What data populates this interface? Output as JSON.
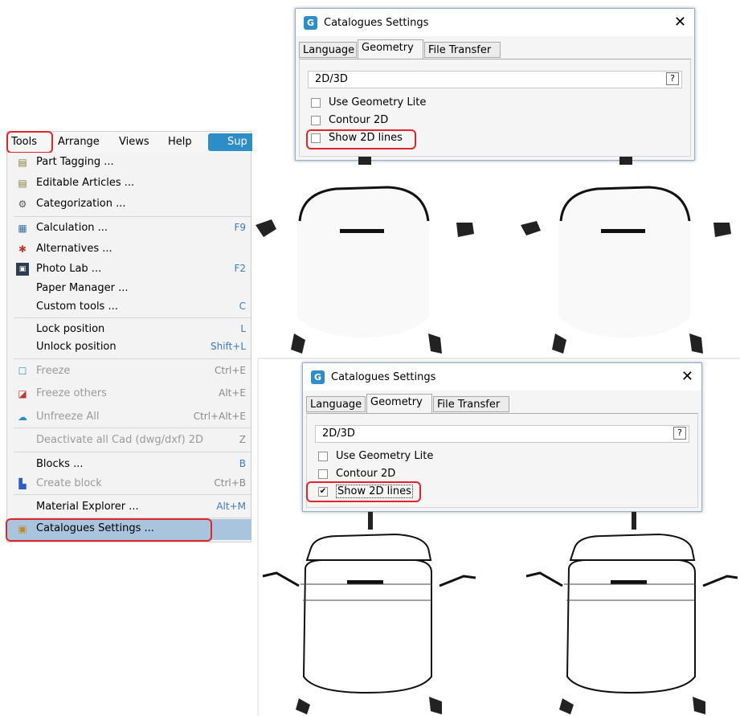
{
  "menubar": {
    "items": [
      "Tools",
      "Arrange",
      "Views",
      "Help"
    ],
    "sup_button": "Sup"
  },
  "tools_menu": {
    "items": [
      {
        "label": "Part Tagging ...",
        "icon": "part-tagging-icon",
        "shortcut": "",
        "disabled": false
      },
      {
        "label": "Editable Articles ...",
        "icon": "editable-articles-icon",
        "shortcut": "",
        "disabled": false
      },
      {
        "label": "Categorization ...",
        "icon": "categorization-icon",
        "shortcut": "",
        "disabled": false
      },
      {
        "label": "Calculation ...",
        "icon": "calculator-icon",
        "shortcut": "F9",
        "disabled": false
      },
      {
        "label": "Alternatives ...",
        "icon": "alternatives-icon",
        "shortcut": "",
        "disabled": false
      },
      {
        "label": "Photo Lab ...",
        "icon": "photo-lab-icon",
        "shortcut": "F2",
        "disabled": false
      },
      {
        "label": "Paper Manager ...",
        "icon": "",
        "shortcut": "",
        "disabled": false
      },
      {
        "label": "Custom tools ...",
        "icon": "",
        "shortcut": "C",
        "disabled": false
      },
      {
        "label": "Lock position",
        "icon": "",
        "shortcut": "L",
        "disabled": false
      },
      {
        "label": "Unlock position",
        "icon": "",
        "shortcut": "Shift+L",
        "disabled": false
      },
      {
        "label": "Freeze",
        "icon": "freeze-icon",
        "shortcut": "Ctrl+E",
        "disabled": true
      },
      {
        "label": "Freeze others",
        "icon": "freeze-others-icon",
        "shortcut": "Alt+E",
        "disabled": true
      },
      {
        "label": "Unfreeze All",
        "icon": "unfreeze-icon",
        "shortcut": "Ctrl+Alt+E",
        "disabled": true
      },
      {
        "label": "Deactivate all Cad (dwg/dxf) 2D",
        "icon": "",
        "shortcut": "Z",
        "disabled": true
      },
      {
        "label": "Blocks ...",
        "icon": "",
        "shortcut": "B",
        "disabled": false
      },
      {
        "label": "Create block",
        "icon": "create-block-icon",
        "shortcut": "Ctrl+B",
        "disabled": true
      },
      {
        "label": "Material Explorer ...",
        "icon": "",
        "shortcut": "Alt+M",
        "disabled": false
      },
      {
        "label": "Catalogues Settings ...",
        "icon": "catalogues-settings-icon",
        "shortcut": "",
        "disabled": false
      }
    ]
  },
  "dialog_top": {
    "title": "Catalogues Settings",
    "close": "✕",
    "tabs": [
      "Language",
      "Geometry",
      "File Transfer"
    ],
    "active_tab": "Geometry",
    "combo_value": "2D/3D",
    "help": "?",
    "checkboxes": [
      {
        "label": "Use Geometry Lite",
        "checked": false
      },
      {
        "label": "Contour 2D",
        "checked": false
      },
      {
        "label": "Show 2D lines",
        "checked": false
      }
    ]
  },
  "dialog_bottom": {
    "title": "Catalogues Settings",
    "close": "✕",
    "tabs": [
      "Language",
      "Geometry",
      "File Transfer"
    ],
    "active_tab": "Geometry",
    "combo_value": "2D/3D",
    "help": "?",
    "checkboxes": [
      {
        "label": "Use Geometry Lite",
        "checked": false
      },
      {
        "label": "Contour 2D",
        "checked": false
      },
      {
        "label": "Show 2D lines",
        "checked": true
      }
    ],
    "check_mark": "✔"
  },
  "colors": {
    "highlight": "#e0262b",
    "selected_row": "#a9c4dd",
    "accent": "#2d8dc6"
  }
}
